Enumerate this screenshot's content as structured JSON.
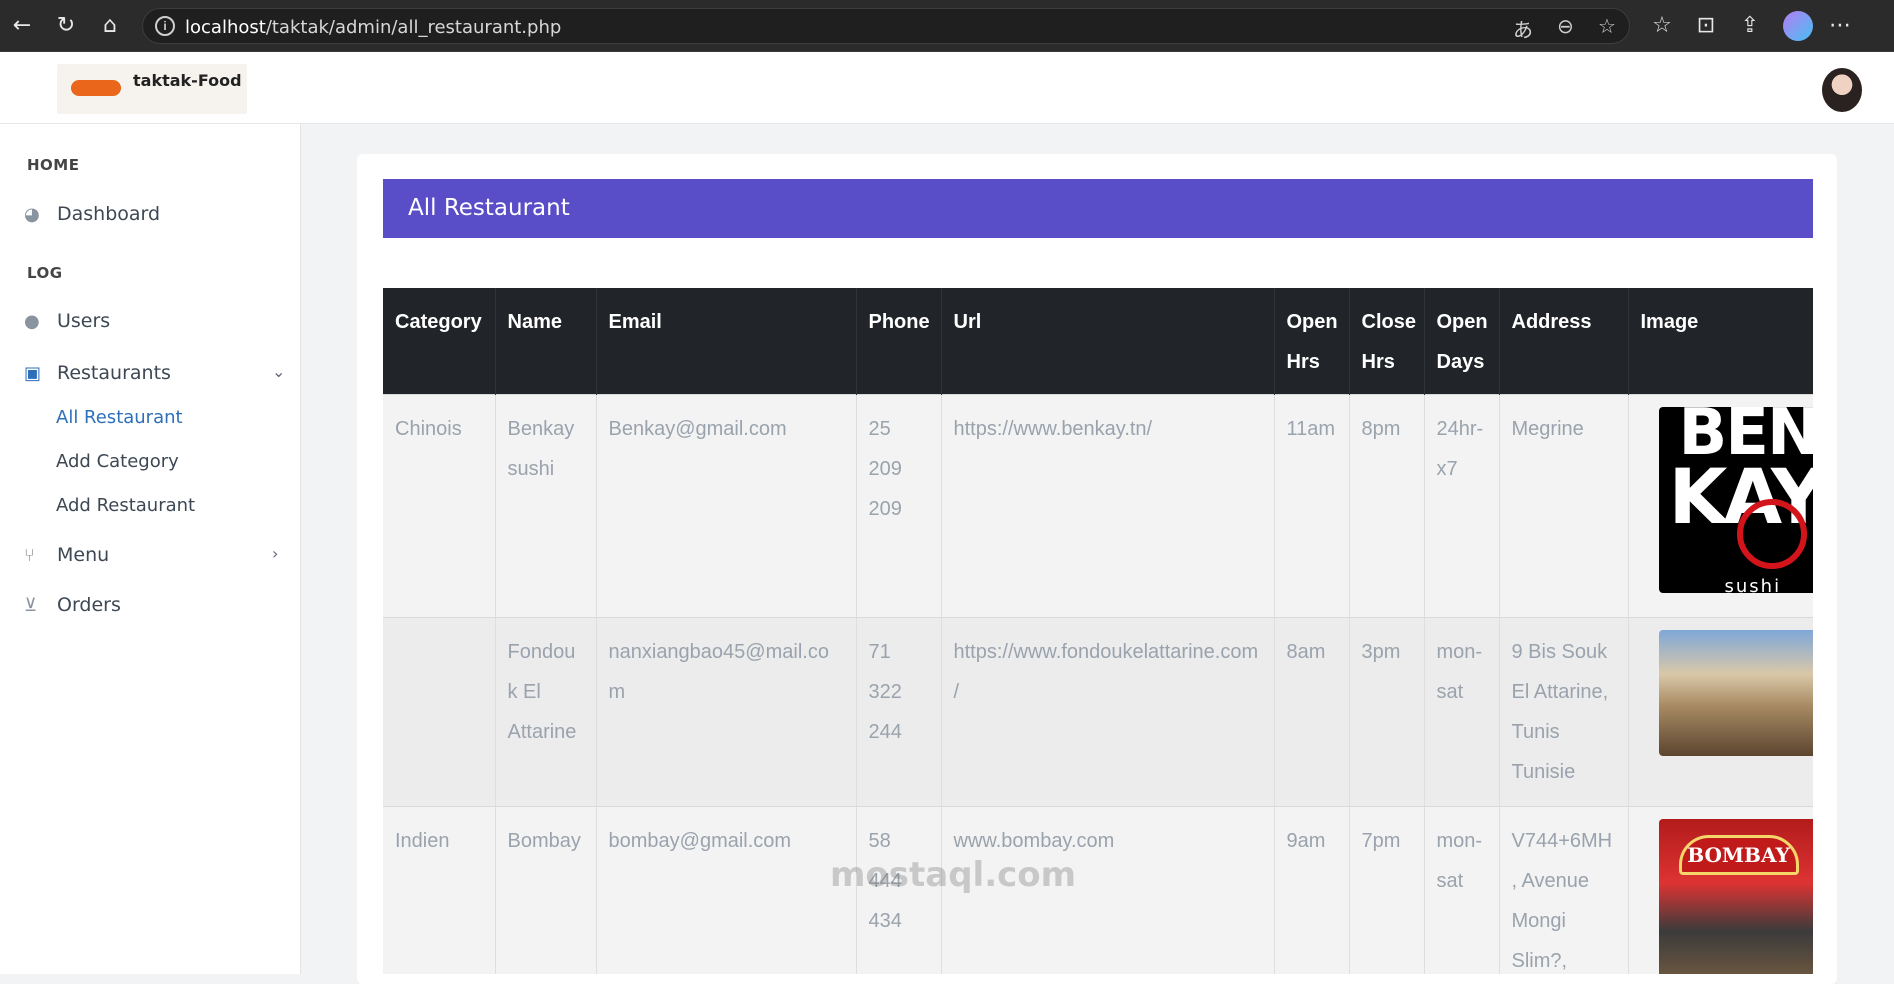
{
  "browser": {
    "url_host": "localhost",
    "url_path": "/taktak/admin/all_restaurant.php"
  },
  "brand": {
    "logo_text": "taktak-Food"
  },
  "sidebar": {
    "sections": [
      "HOME",
      "LOG"
    ],
    "items": [
      {
        "label": "Dashboard",
        "icon": "dashboard-icon"
      },
      {
        "label": "Users",
        "icon": "user-icon"
      },
      {
        "label": "Restaurants",
        "icon": "archive-icon"
      },
      {
        "label": "Menu",
        "icon": "utensils-icon"
      },
      {
        "label": "Orders",
        "icon": "cart-icon"
      }
    ],
    "sub_items": [
      "All Restaurant",
      "Add Category",
      "Add Restaurant"
    ]
  },
  "card": {
    "title": "All Restaurant"
  },
  "table": {
    "headers": [
      "Category",
      "Name",
      "Email",
      "Phone",
      "Url",
      "Open Hrs",
      "Close Hrs",
      "Open Days",
      "Address",
      "Image"
    ],
    "rows": [
      {
        "category": "Chinois",
        "name": "Benkay sushi",
        "email": "Benkay@gmail.com",
        "phone": "25 209 209",
        "url": "https://www.benkay.tn/",
        "open": "11am",
        "close": "8pm",
        "days": "24hr-x7",
        "address": "Megrine",
        "image_text": "BENKAY sushi"
      },
      {
        "category": "",
        "name": "Fondouk El Attarine",
        "email": "nanxiangbao45@mail.com",
        "phone": "71 322 244",
        "url": "https://www.fondoukelattarine.com/",
        "open": "8am",
        "close": "3pm",
        "days": "mon-sat",
        "address": "9 Bis Souk El Attarine, Tunis Tunisie",
        "image_text": ""
      },
      {
        "category": "Indien",
        "name": "Bombay",
        "email": "bombay@gmail.com",
        "phone": "58 444 434",
        "url": "www.bombay.com",
        "open": "9am",
        "close": "7pm",
        "days": "mon-sat",
        "address": "V744+6MH, Avenue Mongi Slim?,",
        "image_text": "BOMBAY"
      }
    ]
  },
  "watermark": "mostaql.com",
  "colors": {
    "header_bg": "#5a4dc8",
    "table_head": "#212529",
    "link": "#2e6fba"
  }
}
